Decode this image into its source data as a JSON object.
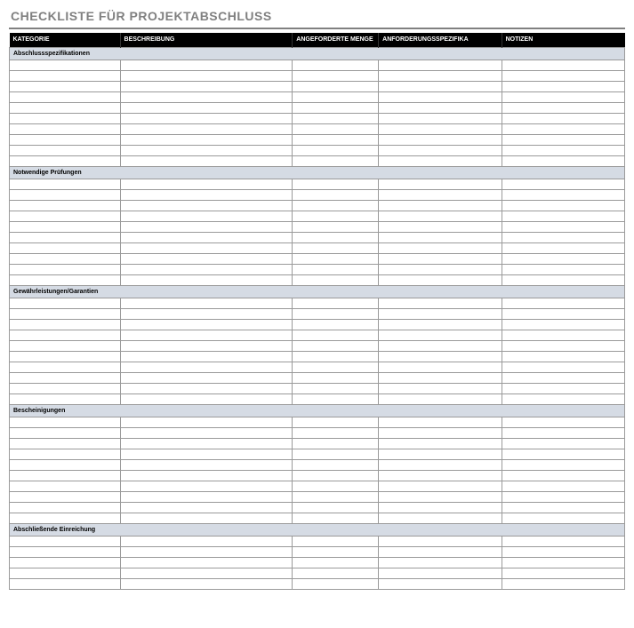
{
  "title": "CHECKLISTE FÜR PROJEKTABSCHLUSS",
  "columns": [
    "KATEGORIE",
    "BESCHREIBUNG",
    "ANGEFORDERTE MENGE",
    "ANFORDERUNGSSPEZIFIKA",
    "NOTIZEN"
  ],
  "sections": [
    {
      "label": "Abschlussspezifikationen",
      "rows": 10
    },
    {
      "label": "Notwendige Prüfungen",
      "rows": 10
    },
    {
      "label": "Gewährleistungen/Garantien",
      "rows": 10
    },
    {
      "label": "Bescheinigungen",
      "rows": 10
    },
    {
      "label": "Abschließende Einreichung",
      "rows": 5
    }
  ]
}
